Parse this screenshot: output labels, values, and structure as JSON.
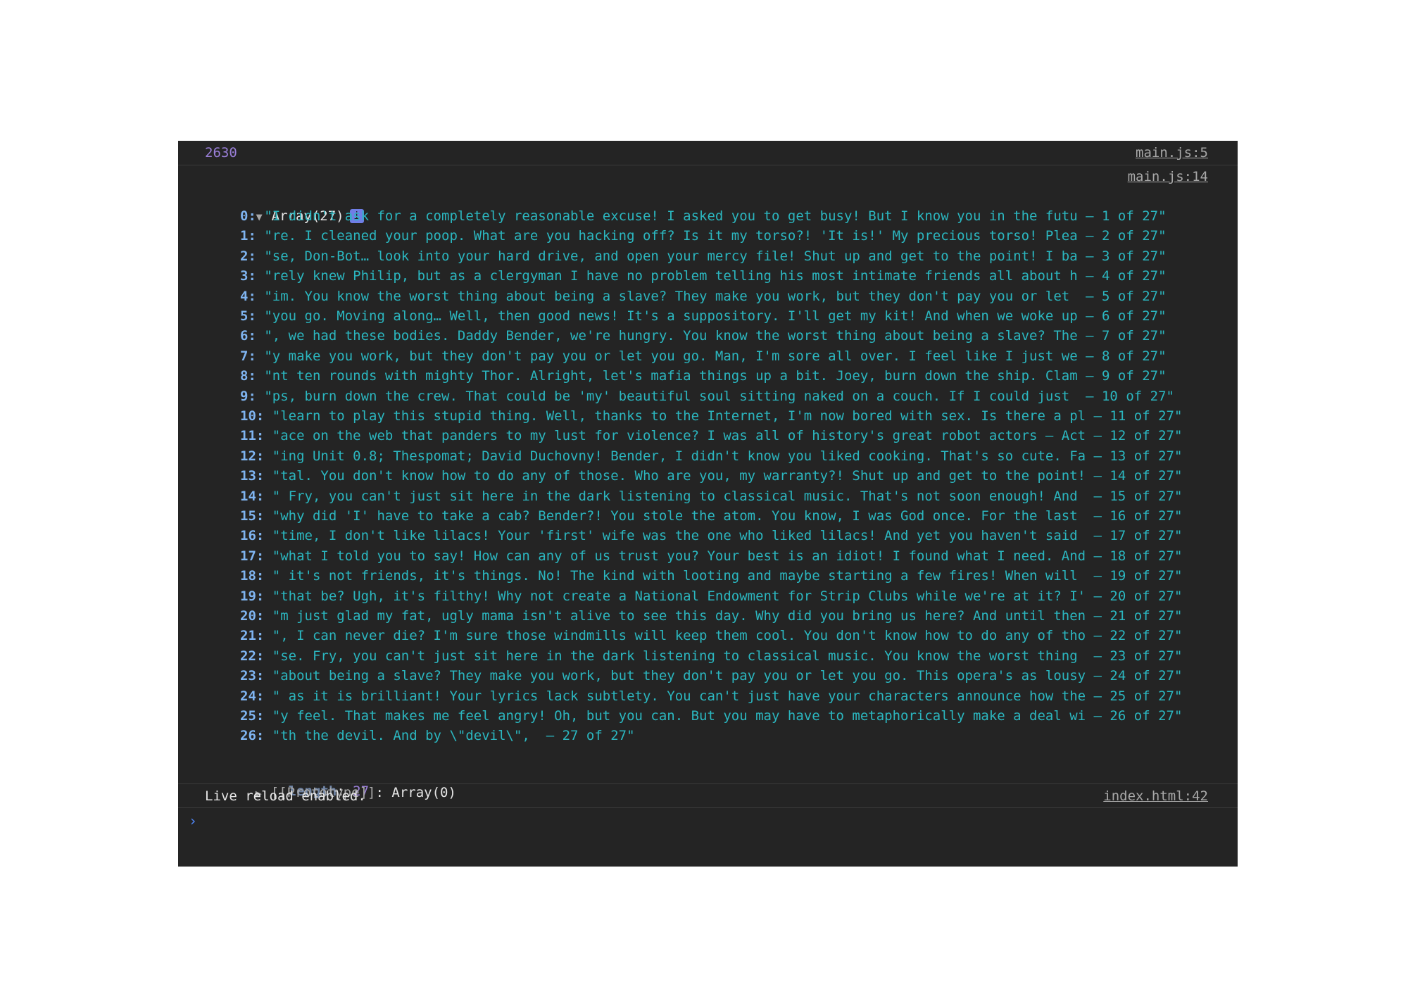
{
  "console": {
    "log1": {
      "value": "2630",
      "source": "main.js:5"
    },
    "log2": {
      "source": "main.js:14",
      "header": "Array(27)",
      "info_badge": "i",
      "entries": [
        {
          "key": "0:",
          "value": "\"I didn't ask for a completely reasonable excuse! I asked you to get busy! But I know you in the futu – 1 of 27\""
        },
        {
          "key": "1:",
          "value": "\"re. I cleaned your poop. What are you hacking off? Is it my torso?! 'It is!' My precious torso! Plea – 2 of 27\""
        },
        {
          "key": "2:",
          "value": "\"se, Don-Bot… look into your hard drive, and open your mercy file! Shut up and get to the point! I ba – 3 of 27\""
        },
        {
          "key": "3:",
          "value": "\"rely knew Philip, but as a clergyman I have no problem telling his most intimate friends all about h – 4 of 27\""
        },
        {
          "key": "4:",
          "value": "\"im. You know the worst thing about being a slave? They make you work, but they don't pay you or let  – 5 of 27\""
        },
        {
          "key": "5:",
          "value": "\"you go. Moving along… Well, then good news! It's a suppository. I'll get my kit! And when we woke up – 6 of 27\""
        },
        {
          "key": "6:",
          "value": "\", we had these bodies. Daddy Bender, we're hungry. You know the worst thing about being a slave? The – 7 of 27\""
        },
        {
          "key": "7:",
          "value": "\"y make you work, but they don't pay you or let you go. Man, I'm sore all over. I feel like I just we – 8 of 27\""
        },
        {
          "key": "8:",
          "value": "\"nt ten rounds with mighty Thor. Alright, let's mafia things up a bit. Joey, burn down the ship. Clam – 9 of 27\""
        },
        {
          "key": "9:",
          "value": "\"ps, burn down the crew. That could be 'my' beautiful soul sitting naked on a couch. If I could just  – 10 of 27\""
        },
        {
          "key": "10:",
          "value": "\"learn to play this stupid thing. Well, thanks to the Internet, I'm now bored with sex. Is there a pl – 11 of 27\""
        },
        {
          "key": "11:",
          "value": "\"ace on the web that panders to my lust for violence? I was all of history's great robot actors – Act – 12 of 27\""
        },
        {
          "key": "12:",
          "value": "\"ing Unit 0.8; Thespomat; David Duchovny! Bender, I didn't know you liked cooking. That's so cute. Fa – 13 of 27\""
        },
        {
          "key": "13:",
          "value": "\"tal. You don't know how to do any of those. Who are you, my warranty?! Shut up and get to the point! – 14 of 27\""
        },
        {
          "key": "14:",
          "value": "\" Fry, you can't just sit here in the dark listening to classical music. That's not soon enough! And  – 15 of 27\""
        },
        {
          "key": "15:",
          "value": "\"why did 'I' have to take a cab? Bender?! You stole the atom. You know, I was God once. For the last  – 16 of 27\""
        },
        {
          "key": "16:",
          "value": "\"time, I don't like lilacs! Your 'first' wife was the one who liked lilacs! And yet you haven't said  – 17 of 27\""
        },
        {
          "key": "17:",
          "value": "\"what I told you to say! How can any of us trust you? Your best is an idiot! I found what I need. And – 18 of 27\""
        },
        {
          "key": "18:",
          "value": "\" it's not friends, it's things. No! The kind with looting and maybe starting a few fires! When will  – 19 of 27\""
        },
        {
          "key": "19:",
          "value": "\"that be? Ugh, it's filthy! Why not create a National Endowment for Strip Clubs while we're at it? I' – 20 of 27\""
        },
        {
          "key": "20:",
          "value": "\"m just glad my fat, ugly mama isn't alive to see this day. Why did you bring us here? And until then – 21 of 27\""
        },
        {
          "key": "21:",
          "value": "\", I can never die? I'm sure those windmills will keep them cool. You don't know how to do any of tho – 22 of 27\""
        },
        {
          "key": "22:",
          "value": "\"se. Fry, you can't just sit here in the dark listening to classical music. You know the worst thing  – 23 of 27\""
        },
        {
          "key": "23:",
          "value": "\"about being a slave? They make you work, but they don't pay you or let you go. This opera's as lousy – 24 of 27\""
        },
        {
          "key": "24:",
          "value": "\" as it is brilliant! Your lyrics lack subtlety. You can't just have your characters announce how the – 25 of 27\""
        },
        {
          "key": "25:",
          "value": "\"y feel. That makes me feel angry! Oh, but you can. But you may have to metaphorically make a deal wi – 26 of 27\""
        },
        {
          "key": "26:",
          "value": "\"th the devil. And by \\\"devil\\\",  – 27 of 27\""
        }
      ],
      "length_key": "length",
      "length_value": "27",
      "prototype_key": "[[Prototype]]",
      "prototype_value": "Array(0)"
    },
    "log3": {
      "text": "Live reload enabled.",
      "source": "index.html:42"
    },
    "prompt_symbol": "›"
  },
  "colors": {
    "background": "#242424",
    "string": "#2bb6bf",
    "number": "#9a7fd8",
    "key": "#7fb4f0",
    "link": "#a8a8a8"
  },
  "icons": [
    "expand-triangle-icon",
    "info-icon",
    "collapsed-triangle-icon",
    "prompt-chevron-icon"
  ]
}
